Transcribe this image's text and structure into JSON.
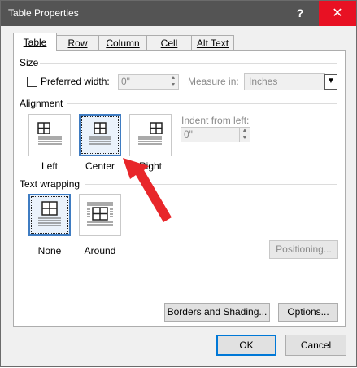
{
  "window": {
    "title": "Table Properties",
    "help_label": "?",
    "close_label": "✕"
  },
  "tabs": [
    {
      "label": "Table",
      "active": true
    },
    {
      "label": "Row"
    },
    {
      "label": "Column"
    },
    {
      "label": "Cell"
    },
    {
      "label": "Alt Text"
    }
  ],
  "size": {
    "group_label": "Size",
    "preferred_width_label": "Preferred width:",
    "preferred_width_value": "0\"",
    "measure_in_label": "Measure in:",
    "measure_in_value": "Inches"
  },
  "alignment": {
    "group_label": "Alignment",
    "options": [
      {
        "label": "Left",
        "selected": false
      },
      {
        "label": "Center",
        "selected": true
      },
      {
        "label": "Right",
        "selected": false
      }
    ],
    "indent_label": "Indent from left:",
    "indent_value": "0\""
  },
  "text_wrapping": {
    "group_label": "Text wrapping",
    "options": [
      {
        "label": "None",
        "selected": true
      },
      {
        "label": "Around",
        "selected": false
      }
    ],
    "positioning_label": "Positioning..."
  },
  "buttons": {
    "borders_label": "Borders and Shading...",
    "options_label": "Options...",
    "ok_label": "OK",
    "cancel_label": "Cancel"
  },
  "colors": {
    "titlebar": "#545454",
    "close_hover": "#e81123",
    "selection_border": "#3f7cc2",
    "annotation_arrow": "#e8262a"
  }
}
